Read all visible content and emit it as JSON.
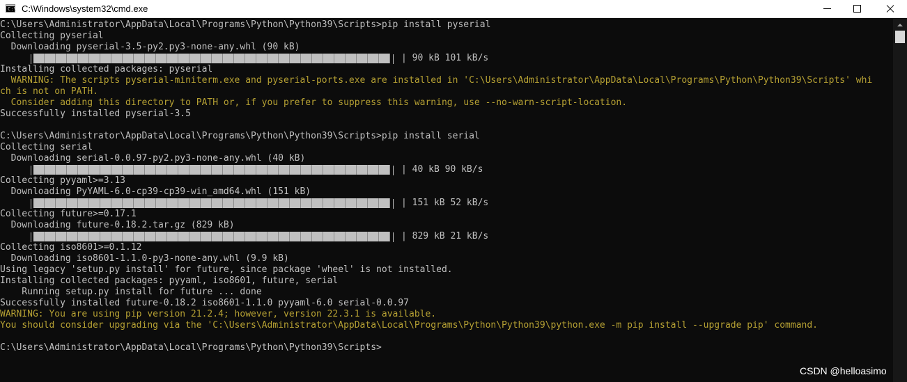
{
  "window": {
    "title": "C:\\Windows\\system32\\cmd.exe",
    "icon": "cmd-icon",
    "controls": {
      "minimize": "minimize-icon",
      "maximize": "maximize-icon",
      "close": "close-icon"
    }
  },
  "console": {
    "lines": [
      "C:\\Users\\Administrator\\AppData\\Local\\Programs\\Python\\Python39\\Scripts>pip install pyserial",
      "Collecting pyserial",
      "  Downloading pyserial-3.5-py2.py3-none-any.whl (90 kB)",
      "",
      "Installing collected packages: pyserial",
      "  WARNING: The scripts pyserial-miniterm.exe and pyserial-ports.exe are installed in 'C:\\Users\\Administrator\\AppData\\Local\\Programs\\Python\\Python39\\Scripts' whi",
      "ch is not on PATH.",
      "  Consider adding this directory to PATH or, if you prefer to suppress this warning, use --no-warn-script-location.",
      "Successfully installed pyserial-3.5",
      "",
      "C:\\Users\\Administrator\\AppData\\Local\\Programs\\Python\\Python39\\Scripts>pip install serial",
      "Collecting serial",
      "  Downloading serial-0.0.97-py2.py3-none-any.whl (40 kB)",
      "",
      "Collecting pyyaml>=3.13",
      "  Downloading PyYAML-6.0-cp39-cp39-win_amd64.whl (151 kB)",
      "",
      "Collecting future>=0.17.1",
      "  Downloading future-0.18.2.tar.gz (829 kB)",
      "",
      "Collecting iso8601>=0.1.12",
      "  Downloading iso8601-1.1.0-py3-none-any.whl (9.9 kB)",
      "Using legacy 'setup.py install' for future, since package 'wheel' is not installed.",
      "Installing collected packages: pyyaml, iso8601, future, serial",
      "    Running setup.py install for future ... done",
      "Successfully installed future-0.18.2 iso8601-1.1.0 pyyaml-6.0 serial-0.0.97",
      "WARNING: You are using pip version 21.2.4; however, version 22.3.1 is available.",
      "You should consider upgrading via the 'C:\\Users\\Administrator\\AppData\\Local\\Programs\\Python\\Python39\\python.exe -m pip install --upgrade pip' command.",
      "",
      "C:\\Users\\Administrator\\AppData\\Local\\Programs\\Python\\Python39\\Scripts>"
    ],
    "warning_color": "#b5a033",
    "text_color": "#c0c0c0",
    "progress": [
      {
        "fraction": 1.0,
        "text": "| 90 kB 101 kB/s"
      },
      {
        "fraction": 1.0,
        "text": "| 40 kB 90 kB/s"
      },
      {
        "fraction": 1.0,
        "text": "| 151 kB 52 kB/s"
      },
      {
        "fraction": 1.0,
        "text": "| 829 kB 21 kB/s"
      }
    ]
  },
  "watermark": "CSDN @helloasimo"
}
